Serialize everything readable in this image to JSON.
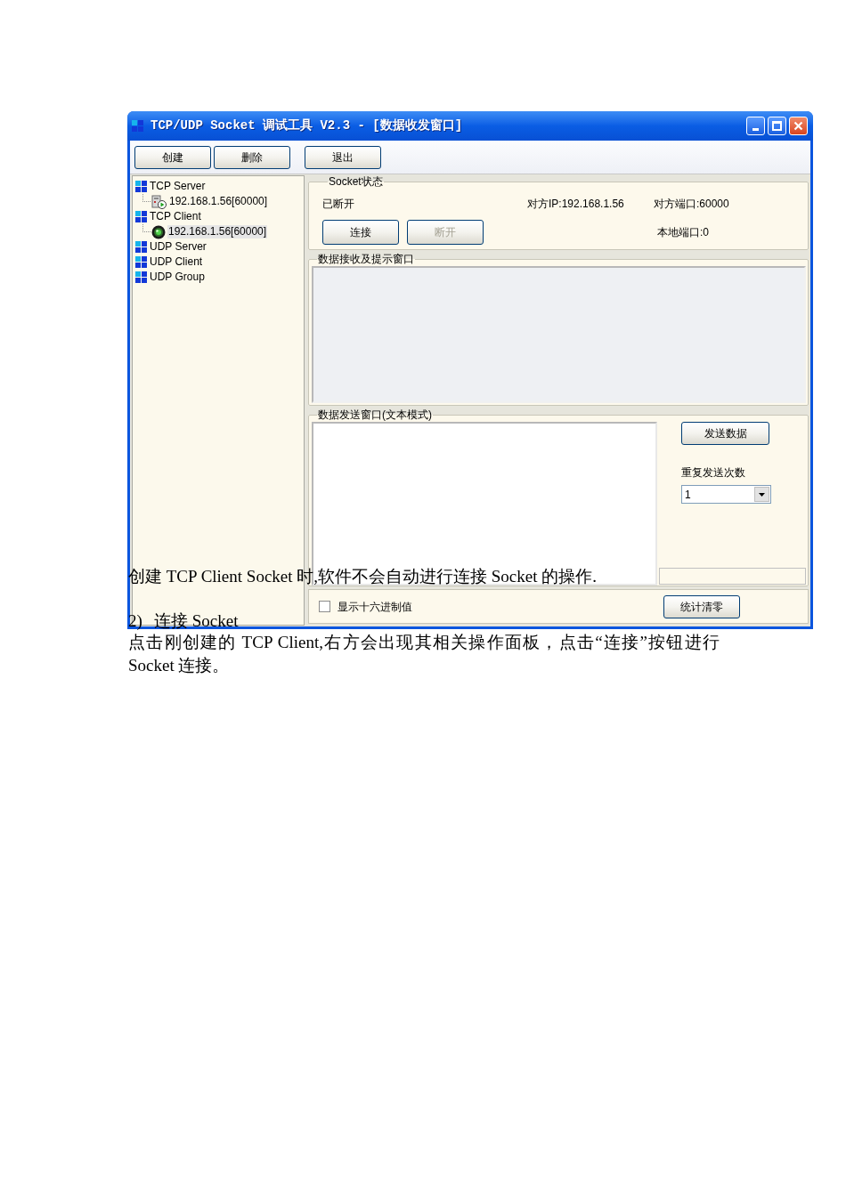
{
  "window": {
    "title": "TCP/UDP Socket 调试工具 V2.3 - [数据收发窗口]"
  },
  "toolbar": {
    "buttons": [
      {
        "label": "创建"
      },
      {
        "label": "删除"
      },
      {
        "label": "退出"
      }
    ]
  },
  "tree": [
    {
      "label": "TCP Server",
      "kind": "category",
      "selected": false,
      "children": [
        {
          "label": "192.168.1.56[60000]",
          "kind": "server",
          "selected": false
        }
      ]
    },
    {
      "label": "TCP Client",
      "kind": "category",
      "selected": false,
      "children": [
        {
          "label": "192.168.1.56[60000]",
          "kind": "client",
          "selected": true
        }
      ]
    },
    {
      "label": "UDP Server",
      "kind": "category",
      "selected": false
    },
    {
      "label": "UDP Client",
      "kind": "category",
      "selected": false
    },
    {
      "label": "UDP Group",
      "kind": "category",
      "selected": false
    }
  ],
  "socket_status": {
    "title": "Socket状态",
    "state": "已断开",
    "remote_ip": "对方IP:192.168.1.56",
    "remote_port": "对方端口:60000",
    "local_port": "本地端口:0",
    "buttons": [
      {
        "label": "连接",
        "disabled": false
      },
      {
        "label": "断开",
        "disabled": true
      }
    ]
  },
  "receive_window": {
    "title": "数据接收及提示窗口"
  },
  "send_window": {
    "title": "数据发送窗口(文本模式)",
    "send_button": "发送数据",
    "repeat_label": "重复发送次数",
    "repeat_count": {
      "value": "1"
    }
  },
  "footer": {
    "hex_checkbox": {
      "label": "显示十六进制值",
      "checked": false
    },
    "reset_button": "统计清零"
  },
  "document_text": [
    {
      "kind": "paragraph",
      "text": "创建 TCP Client Socket 时,软件不会自动进行连接 Socket 的操作."
    },
    {
      "kind": "heading",
      "number": "2)",
      "text": "连接 Socket"
    },
    {
      "kind": "paragraph",
      "text": "点击刚创建的 TCP Client,右方会出现其相关操作面板，点击“连接”按钮进行 Socket 连接。"
    }
  ]
}
